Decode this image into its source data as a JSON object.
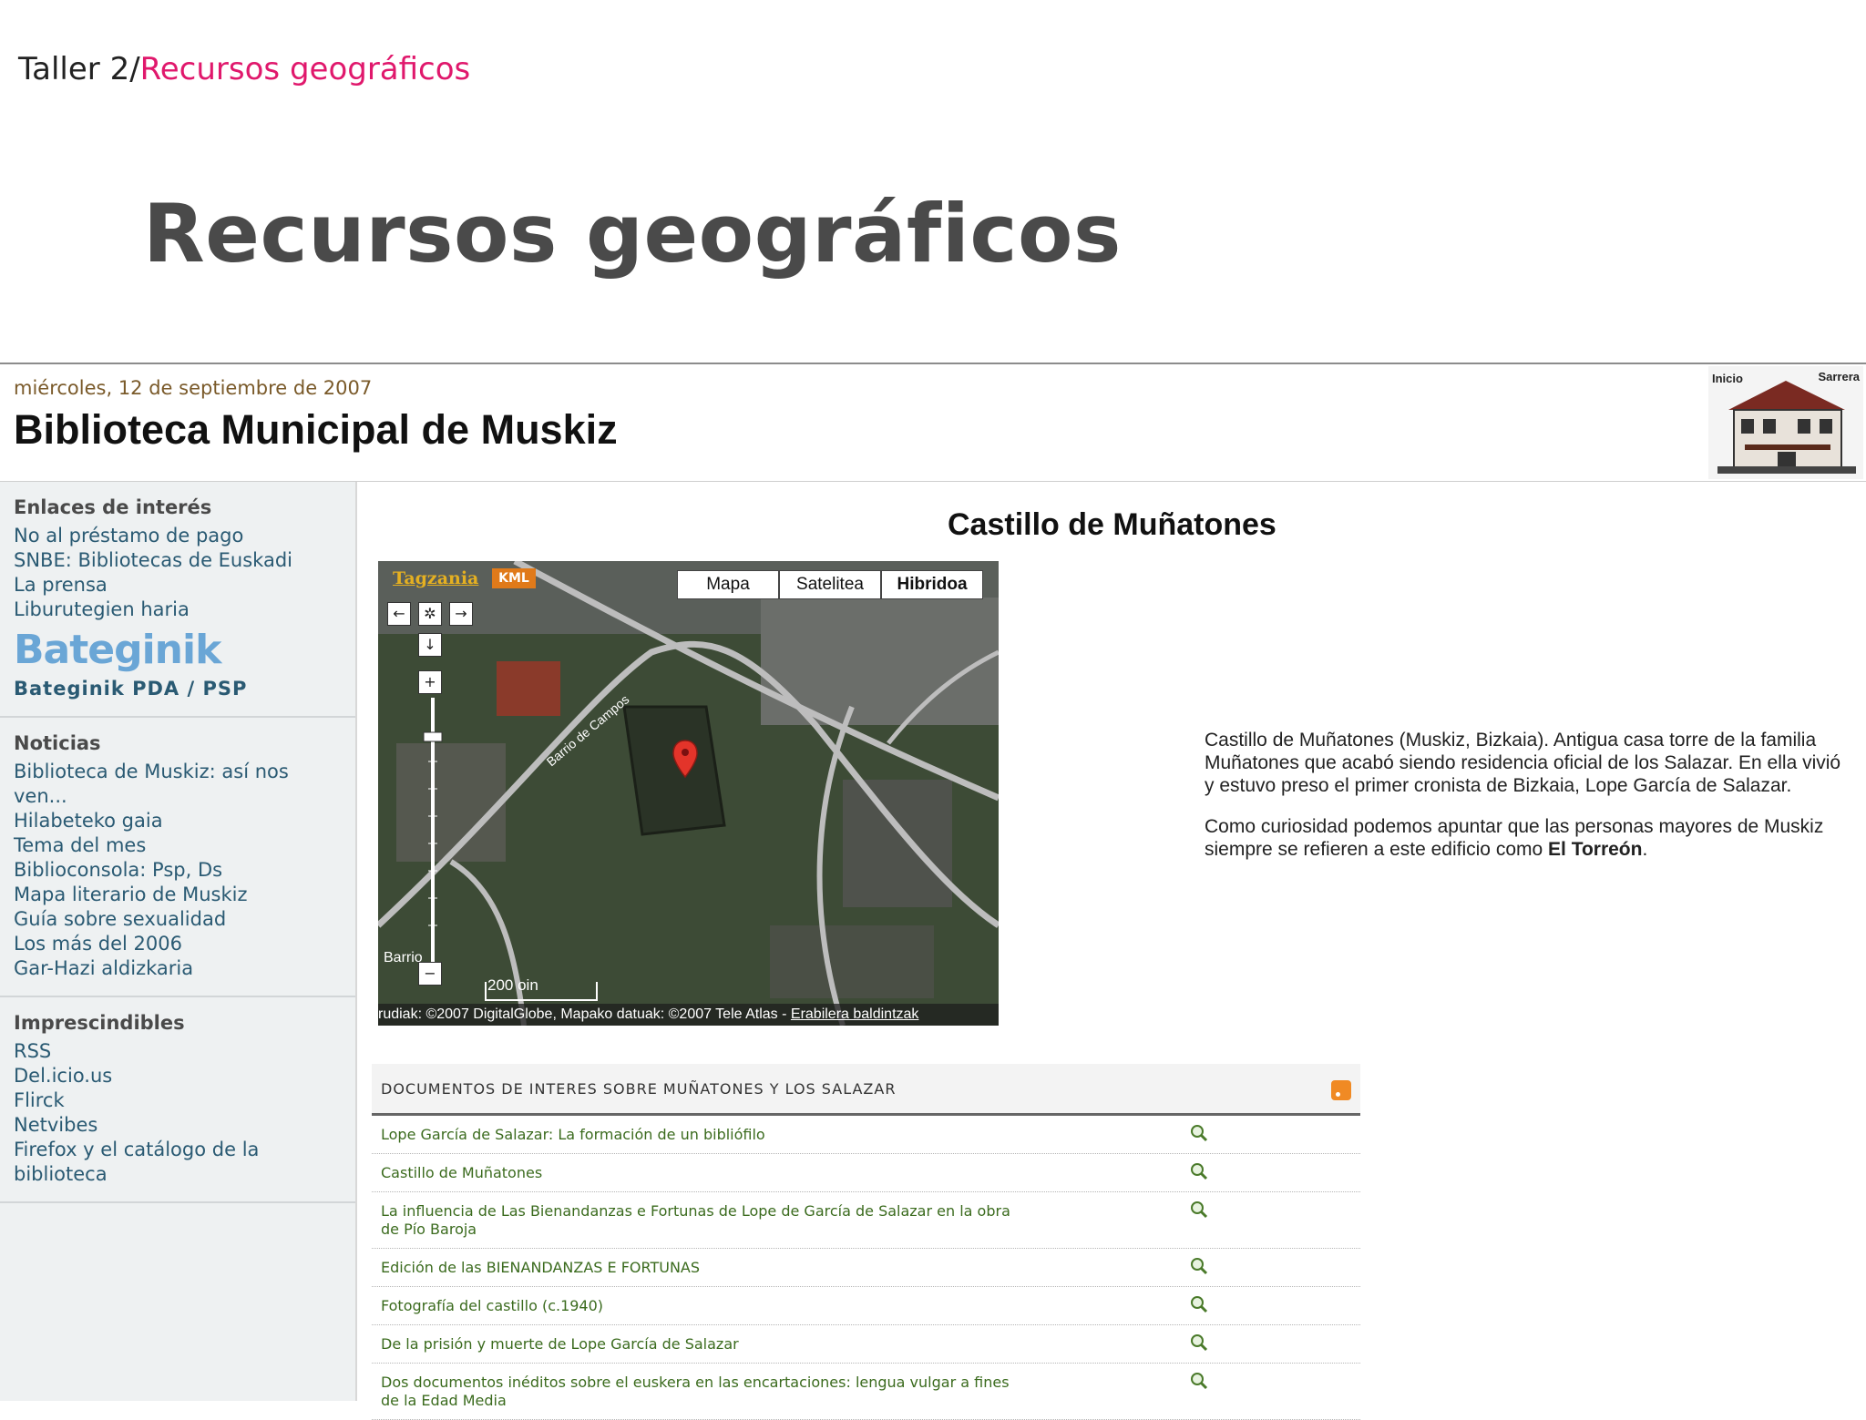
{
  "slide": {
    "breadcrumb_prefix": "Taller 2/",
    "breadcrumb_current": "Recursos geográficos",
    "title": "Recursos geográficos"
  },
  "page": {
    "date": "miércoles, 12 de septiembre de 2007",
    "site_title": "Biblioteca Municipal de Muskiz",
    "logo_labels": [
      "Inicio",
      "Sarrera"
    ]
  },
  "sidebar": {
    "sections": [
      {
        "title": "Enlaces de interés",
        "links": [
          "No al préstamo de pago",
          "SNBE: Bibliotecas de Euskadi",
          "La prensa",
          "Liburutegien haria"
        ],
        "banner": "Bateginik",
        "banner_link": "Bateginik PDA / PSP"
      },
      {
        "title": "Noticias",
        "links": [
          "Biblioteca de Muskiz: así nos ven...",
          "Hilabeteko gaia",
          "Tema del mes",
          "Biblioconsola: Psp, Ds",
          "Mapa literario de Muskiz",
          "Guía sobre sexualidad",
          "Los más del 2006",
          "Gar-Hazi aldizkaria"
        ]
      },
      {
        "title": "Imprescindibles",
        "links": [
          "RSS",
          "Del.icio.us",
          "Flirck",
          "Netvibes",
          "Firefox y el catálogo de la biblioteca"
        ]
      }
    ]
  },
  "main": {
    "title": "Castillo de Muñatones",
    "map": {
      "provider_label": "Tagzania",
      "kml_label": "KML",
      "types": [
        "Mapa",
        "Satelitea",
        "Hibridoa"
      ],
      "active_type": "Hibridoa",
      "street_label": "Barrio de Campos",
      "street_label2": "Barrio",
      "scale_label": "200 oin",
      "attribution": "rudiak: ©2007 DigitalGlobe, Mapako datuak: ©2007 Tele Atlas - ",
      "terms_link": "Erabilera baldintzak",
      "icons": [
        "arrow-left-icon",
        "center-icon",
        "arrow-right-icon",
        "arrow-down-icon",
        "zoom-in-icon",
        "zoom-out-icon",
        "map-marker-icon"
      ]
    },
    "description": {
      "p1": "Castillo de Muñatones (Muskiz, Bizkaia). Antigua casa torre de la familia Muñatones que acabó siendo residencia oficial de los Salazar. En ella vivió y estuvo preso el primer cronista de Bizkaia, Lope García de Salazar.",
      "p2_prefix": "Como curiosidad podemos apuntar que las personas mayores de Muskiz siempre se refieren a este edificio como ",
      "p2_bold": "El Torreón",
      "p2_suffix": "."
    },
    "documents": {
      "header": "DOCUMENTOS DE INTERES SOBRE MUÑATONES Y LOS SALAZAR",
      "items": [
        "Lope García de Salazar: La formación de un bibliófilo",
        "Castillo de Muñatones",
        "La influencia de Las Bienandanzas e Fortunas de Lope de García de Salazar en la obra de Pío Baroja",
        "Edición de las BIENANDANZAS E FORTUNAS",
        "Fotografía del castillo (c.1940)",
        "De la prisión y muerte de Lope García de Salazar",
        "Dos documentos inéditos sobre el euskera en las encartaciones: lengua vulgar a fines de la Edad Media"
      ]
    }
  },
  "colors": {
    "breadcrumb_accent": "#e0186c",
    "slide_title": "#4a4a4a",
    "sidebar_link": "#2a5a73",
    "doc_link": "#3b6b1e",
    "sidebar_bg": "#eef1f2"
  }
}
